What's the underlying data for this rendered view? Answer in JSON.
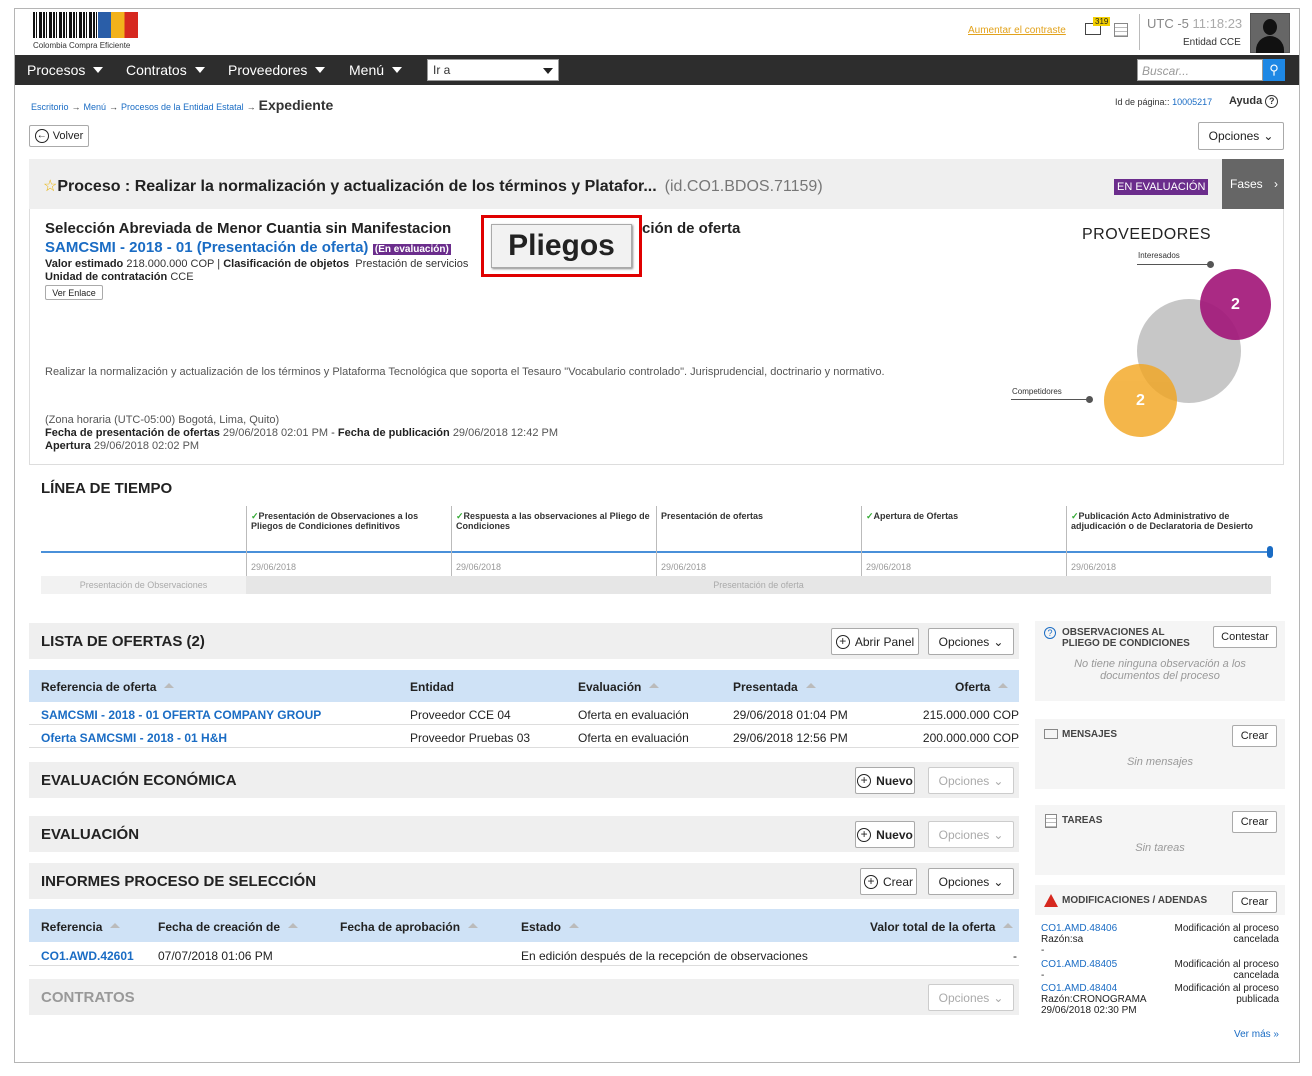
{
  "header": {
    "logo_text": "Colombia Compra Eficiente",
    "contrast_link": "Aumentar el contraste",
    "mail_count": "319",
    "utc_label": "UTC -5",
    "time": "11:18:23",
    "entity": "Entidad CCE"
  },
  "nav": {
    "items": [
      "Procesos",
      "Contratos",
      "Proveedores",
      "Menú"
    ],
    "goto_value": "Ir a",
    "search_placeholder": "Buscar..."
  },
  "breadcrumb": {
    "items": [
      "Escritorio",
      "Menú",
      "Procesos de la Entidad Estatal"
    ],
    "current": "Expediente",
    "arrow": "→"
  },
  "page_id": {
    "label": "Id de página::",
    "value": "10005217"
  },
  "help": "Ayuda",
  "back_button": "Volver",
  "options_button": "Opciones",
  "process": {
    "title": "Proceso : Realizar la normalización y actualización de los términos y Platafor...",
    "id": "(id.CO1.BDOS.71159)",
    "status_badge": "EN EVALUACIÓN",
    "phases": "Fases",
    "type": "Selección Abreviada de Menor Cuantia sin Manifestacion de interés - Presentación de oferta",
    "type_left": "Selección Abreviada de Menor Cuantia sin Manifestacion",
    "type_right": "ción de oferta",
    "reference": "SAMCSMI - 2018 - 01 (Presentación de oferta)",
    "eval_badge": "(En evaluación)",
    "value_label": "Valor estimado",
    "value": "218.000.000 COP",
    "class_label": "Clasificación de objetos",
    "class_value": "Prestación de servicios",
    "unit_label": "Unidad de contratación",
    "unit_value": "CCE",
    "link_button": "Ver Enlace",
    "description": "Realizar la normalización y actualización de los términos y Plataforma Tecnológica que soporta el Tesauro \"Vocabulario controlado\". Jurisprudencial, doctrinario y normativo.",
    "timezone": "(Zona horaria (UTC-05:00) Bogotá, Lima, Quito)",
    "offers_date_label": "Fecha de presentación de ofertas",
    "offers_date": "29/06/2018 02:01 PM",
    "pub_label": "Fecha de publicación",
    "pub_date": "29/06/2018 12:42 PM",
    "opening_label": "Apertura",
    "opening_date": "29/06/2018 02:02 PM"
  },
  "pliegos_button": "Pliegos",
  "providers": {
    "title": "PROVEEDORES",
    "interested_label": "Interesados",
    "interested": "2",
    "competitors_label": "Competidores",
    "competitors": "2"
  },
  "timeline": {
    "title": "LÍNEA DE TIEMPO",
    "events": [
      {
        "label": "Presentación de Observaciones a los Pliegos de Condiciones definitivos",
        "date": "29/06/2018",
        "check": "✓"
      },
      {
        "label": "Respuesta a las observaciones al Pliego de Condiciones",
        "date": "29/06/2018",
        "check": "✓"
      },
      {
        "label": "Presentación de ofertas",
        "date": "29/06/2018",
        "check": ""
      },
      {
        "label": "Apertura de Ofertas",
        "date": "29/06/2018",
        "check": "✓"
      },
      {
        "label": "Publicación Acto Administrativo de adjudicación o de Declaratoria de Desierto",
        "date": "29/06/2018",
        "check": "✓"
      }
    ],
    "phase1": "Presentación de Observaciones",
    "phase2": "Presentación de oferta"
  },
  "offers": {
    "title": "LISTA DE OFERTAS (2)",
    "open_panel": "Abrir Panel",
    "options": "Opciones",
    "columns": [
      "Referencia de oferta",
      "Entidad",
      "Evaluación",
      "Presentada",
      "Oferta"
    ],
    "rows": [
      {
        "ref": "SAMCSMI - 2018 - 01 OFERTA COMPANY GROUP",
        "entity": "Proveedor CCE 04",
        "eval": "Oferta en evaluación",
        "date": "29/06/2018 01:04 PM",
        "amount": "215.000.000 COP"
      },
      {
        "ref": "Oferta SAMCSMI - 2018 - 01 H&H",
        "entity": "Proveedor Pruebas 03",
        "eval": "Oferta en evaluación",
        "date": "29/06/2018 12:56 PM",
        "amount": "200.000.000 COP"
      }
    ]
  },
  "economic": {
    "title": "EVALUACIÓN ECONÓMICA",
    "new": "Nuevo",
    "options": "Opciones"
  },
  "evaluation": {
    "title": "EVALUACIÓN",
    "new": "Nuevo",
    "options": "Opciones"
  },
  "reports": {
    "title": "INFORMES PROCESO DE SELECCIÓN",
    "create": "Crear",
    "options": "Opciones",
    "columns": [
      "Referencia",
      "Fecha de creación de",
      "Fecha de aprobación",
      "Estado",
      "Valor total de la oferta"
    ],
    "rows": [
      {
        "ref": "CO1.AWD.42601",
        "created": "07/07/2018 01:06 PM",
        "approved": "",
        "status": "En edición después de la recepción de observaciones",
        "value": "-"
      }
    ]
  },
  "contracts": {
    "title": "CONTRATOS",
    "options": "Opciones"
  },
  "sidebar": {
    "observations": {
      "title1": "OBSERVACIONES AL",
      "title2": "PLIEGO DE CONDICIONES",
      "button": "Contestar",
      "empty1": "No tiene ninguna observación a los",
      "empty2": "documentos del proceso"
    },
    "messages": {
      "title": "MENSAJES",
      "button": "Crear",
      "empty": "Sin mensajes"
    },
    "tasks": {
      "title": "TAREAS",
      "button": "Crear",
      "empty": "Sin tareas"
    },
    "amendments": {
      "title": "MODIFICACIONES / ADENDAS",
      "button": "Crear",
      "more": "Ver más »",
      "items": [
        {
          "id": "CO1.AMD.48406",
          "sub": "Razón:sa",
          "sub2": "-",
          "status1": "Modificación al proceso",
          "status2": "cancelada"
        },
        {
          "id": "CO1.AMD.48405",
          "sub": "-",
          "sub2": "",
          "status1": "Modificación al proceso",
          "status2": "cancelada"
        },
        {
          "id": "CO1.AMD.48404",
          "sub": "Razón:CRONOGRAMA",
          "sub2": "29/06/2018 02:30 PM",
          "status1": "Modificación al proceso",
          "status2": "publicada"
        }
      ]
    }
  }
}
